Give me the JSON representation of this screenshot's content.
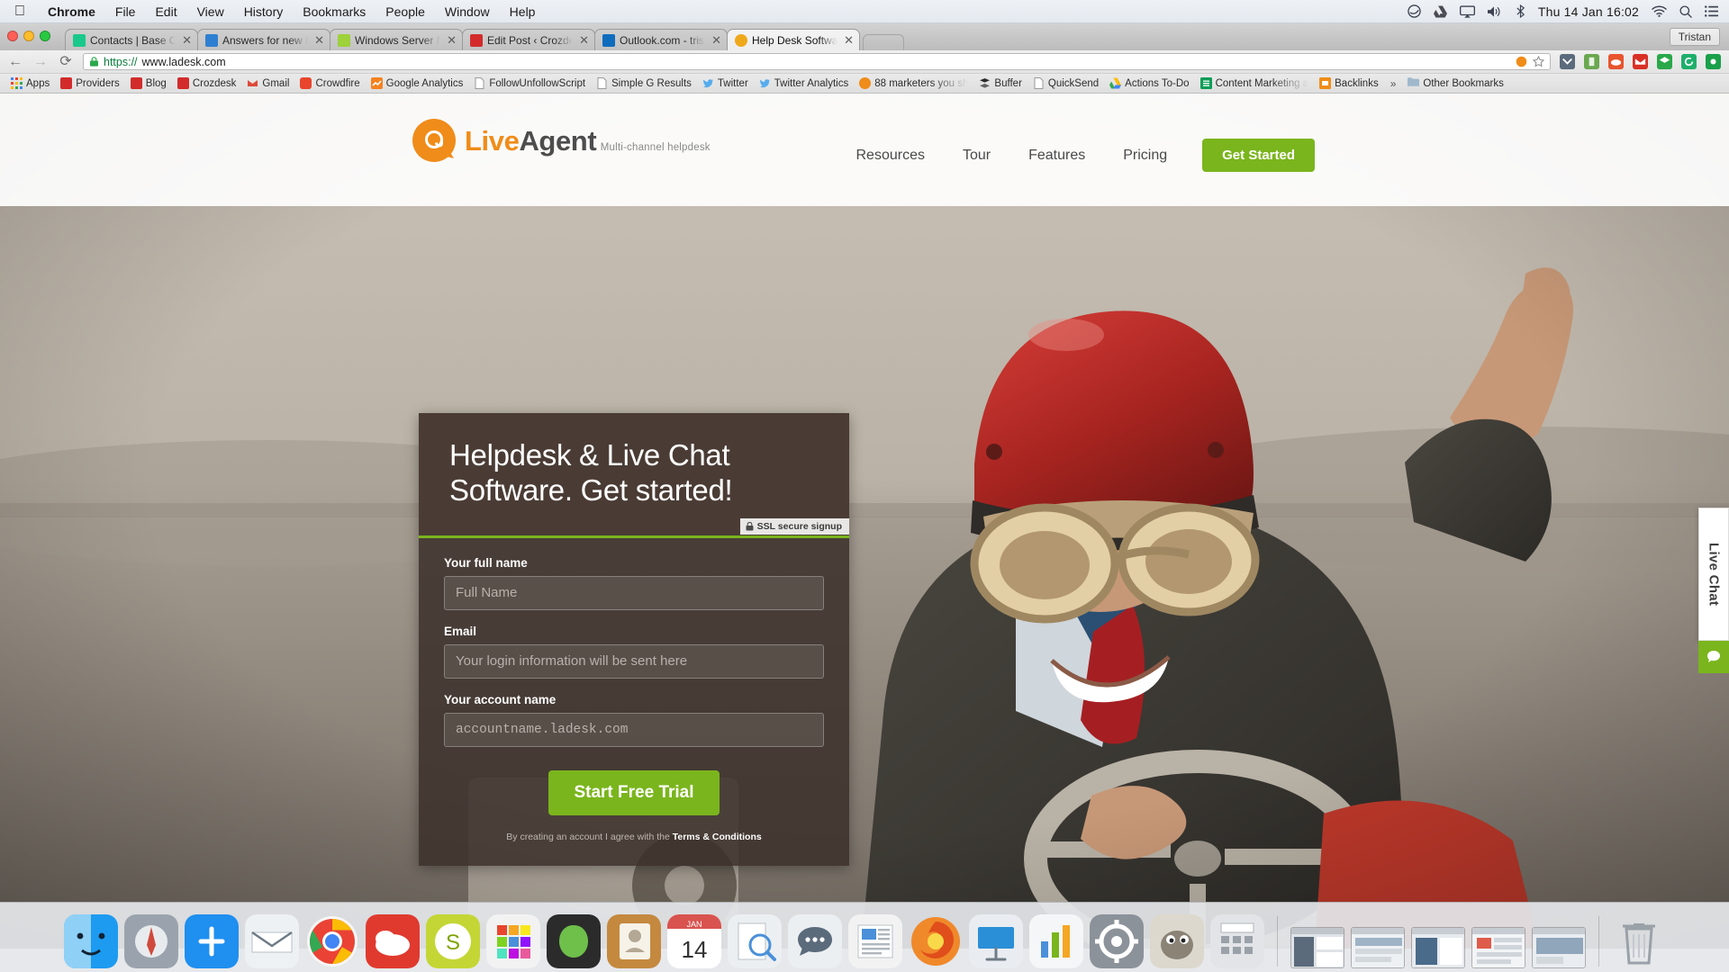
{
  "menubar": {
    "apple_icon": "apple-logo",
    "items": [
      "Chrome",
      "File",
      "Edit",
      "View",
      "History",
      "Bookmarks",
      "People",
      "Window",
      "Help"
    ],
    "status_icons": [
      "grammarly-icon",
      "google-drive-icon",
      "airplay-icon",
      "volume-icon",
      "bluetooth-icon"
    ],
    "clock": "Thu 14 Jan  16:02",
    "right_icons": [
      "wifi-icon",
      "spotlight-search-icon",
      "notification-center-icon"
    ]
  },
  "browser": {
    "profile_label": "Tristan",
    "tabs": [
      {
        "title": "Contacts | Base CRM",
        "favicon": "base-crm-icon",
        "favicon_color": "#19c98b",
        "active": false
      },
      {
        "title": "Answers for new business",
        "favicon": "document-icon",
        "favicon_color": "#2f7fd1",
        "active": false
      },
      {
        "title": "Windows Server Network S",
        "favicon": "cursor-icon",
        "favicon_color": "#9ed13a",
        "active": false
      },
      {
        "title": "Edit Post ‹ Crozdesk Blog",
        "favicon": "crozdesk-icon",
        "favicon_color": "#d32b2b",
        "active": false
      },
      {
        "title": "Outlook.com - tristanh-c@",
        "favicon": "outlook-icon",
        "favicon_color": "#0f6cbd",
        "active": false
      },
      {
        "title": "Help Desk Software | Live C",
        "favicon": "liveagent-icon",
        "favicon_color": "#f0a81b",
        "active": true
      }
    ],
    "toolbar": {
      "back_label": "←",
      "forward_label": "→",
      "reload_label": "⟳",
      "url_scheme": "https://",
      "url_rest": "www.ladesk.com",
      "secure_icon": "green-lock-icon",
      "omni_icons": [
        "bookmark-star-icon",
        "extension-orange-icon"
      ],
      "toolbar_icons": [
        "pocket-icon",
        "evernote-icon",
        "cloud-icon",
        "gmail-icon",
        "buffer-icon",
        "reload-ext-icon",
        "colorzilla-icon"
      ]
    },
    "bookmarks": [
      {
        "label": "Apps",
        "icon": "apps-grid-icon",
        "color": "#4285f4"
      },
      {
        "label": "Providers",
        "icon": "crozdesk-icon",
        "color": "#d32b2b"
      },
      {
        "label": "Blog",
        "icon": "cloud-icon",
        "color": "#d32b2b"
      },
      {
        "label": "Crozdesk",
        "icon": "crozdesk-icon",
        "color": "#d32b2b"
      },
      {
        "label": "Gmail",
        "icon": "gmail-icon",
        "color": "#dd4b39"
      },
      {
        "label": "Crowdfire",
        "icon": "crowdfire-icon",
        "color": "#e8452c"
      },
      {
        "label": "Google Analytics",
        "icon": "analytics-icon",
        "color": "#f58220"
      },
      {
        "label": "FollowUnfollowScript",
        "icon": "page-icon",
        "color": "#9a9a9a"
      },
      {
        "label": "Simple G Results",
        "icon": "page-icon",
        "color": "#9a9a9a"
      },
      {
        "label": "Twitter",
        "icon": "twitter-icon",
        "color": "#55acee"
      },
      {
        "label": "Twitter Analytics",
        "icon": "twitter-icon",
        "color": "#55acee"
      },
      {
        "label": "88 marketers you sh",
        "icon": "orange-circle-icon",
        "color": "#f08c19",
        "truncated": true
      },
      {
        "label": "Buffer",
        "icon": "buffer-icon",
        "color": "#2c2c2c"
      },
      {
        "label": "QuickSend",
        "icon": "page-icon",
        "color": "#9a9a9a"
      },
      {
        "label": "Actions To-Do",
        "icon": "google-drive-icon",
        "color": "#fbbc05"
      },
      {
        "label": "Content Marketing a",
        "icon": "sheets-icon",
        "color": "#0f9d58",
        "truncated": true
      },
      {
        "label": "Backlinks",
        "icon": "orange-page-icon",
        "color": "#f08c19"
      }
    ],
    "bookmarks_overflow": "»",
    "other_bookmarks": {
      "label": "Other Bookmarks",
      "icon": "folder-icon"
    }
  },
  "site": {
    "logo": {
      "title_light": "Live",
      "title_bold": "Agent",
      "subtitle": "Multi-channel helpdesk",
      "mark": "at-sign-speech-bubble-icon"
    },
    "nav": [
      "Resources",
      "Tour",
      "Features",
      "Pricing"
    ],
    "cta": "Get Started",
    "accent_green": "#7ab51d",
    "accent_orange": "#f08c19",
    "hero": {
      "headline": "Helpdesk & Live Chat Software. Get started!",
      "ssl_badge": "SSL secure signup",
      "fields": [
        {
          "label": "Your full name",
          "placeholder": "Full Name",
          "value": "",
          "name": "fullname"
        },
        {
          "label": "Email",
          "placeholder": "Your login information will be sent here",
          "value": "",
          "name": "email"
        },
        {
          "label": "Your account name",
          "placeholder": "accountname.ladesk.com",
          "value": "",
          "name": "accountname"
        }
      ],
      "submit": "Start Free Trial",
      "terms_prefix": "By creating an account I agree with the ",
      "terms_link": "Terms & Conditions"
    },
    "live_chat": {
      "label": "Live Chat",
      "icon": "chat-bubble-icon"
    }
  },
  "dock": {
    "items": [
      {
        "name": "finder",
        "color": "#2a9fe8"
      },
      {
        "name": "launchpad",
        "color": "#8f8f8f"
      },
      {
        "name": "app-store",
        "color": "#1f8ff0"
      },
      {
        "name": "mail",
        "color": "#e8eaed"
      },
      {
        "name": "chrome",
        "color": "#f4f4f4"
      },
      {
        "name": "creative-cloud",
        "color": "#e23a32"
      },
      {
        "name": "skype",
        "color": "#c8d93a"
      },
      {
        "name": "colors-app",
        "color": "#f0f0f0"
      },
      {
        "name": "evernote",
        "color": "#3a3a3a"
      },
      {
        "name": "contacts",
        "color": "#c4893f"
      },
      {
        "name": "calendar",
        "color": "#ffffff",
        "badge": "JAN 14"
      },
      {
        "name": "preview",
        "color": "#e6e6e6"
      },
      {
        "name": "messages",
        "color": "#e9ecef"
      },
      {
        "name": "news",
        "color": "#f2f2f2"
      },
      {
        "name": "firefox",
        "color": "#e86f1e"
      },
      {
        "name": "keynote",
        "color": "#2a8fd6"
      },
      {
        "name": "numbers",
        "color": "#7ab51d"
      },
      {
        "name": "settings",
        "color": "#707070"
      },
      {
        "name": "gimp",
        "color": "#d8d3c8"
      },
      {
        "name": "calculator",
        "color": "#d6d6d6"
      }
    ],
    "minimized_windows": 5,
    "trash": "trash-icon"
  }
}
